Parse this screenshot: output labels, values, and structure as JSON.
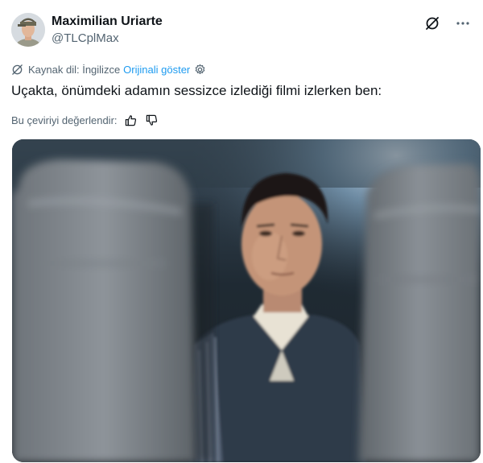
{
  "user": {
    "display_name": "Maximilian Uriarte",
    "handle": "@TLCplMax"
  },
  "translation": {
    "source_label": "Kaynak dil: İngilizce",
    "show_original_label": "Orijinali göster"
  },
  "tweet": {
    "text": "Uçakta, önümdeki adamın sessizce izlediği filmi izlerken ben:"
  },
  "rating": {
    "label": "Bu çeviriyi değerlendir:"
  },
  "icons": {
    "header": [
      "grok-icon",
      "more-icon"
    ],
    "translate": "translate-icon",
    "settings": "gear-icon",
    "rate": [
      "thumbs-up-icon",
      "thumbs-down-icon"
    ]
  },
  "colors": {
    "link": "#1d9bf0",
    "secondary_text": "#536471",
    "primary_text": "#0f1419"
  }
}
